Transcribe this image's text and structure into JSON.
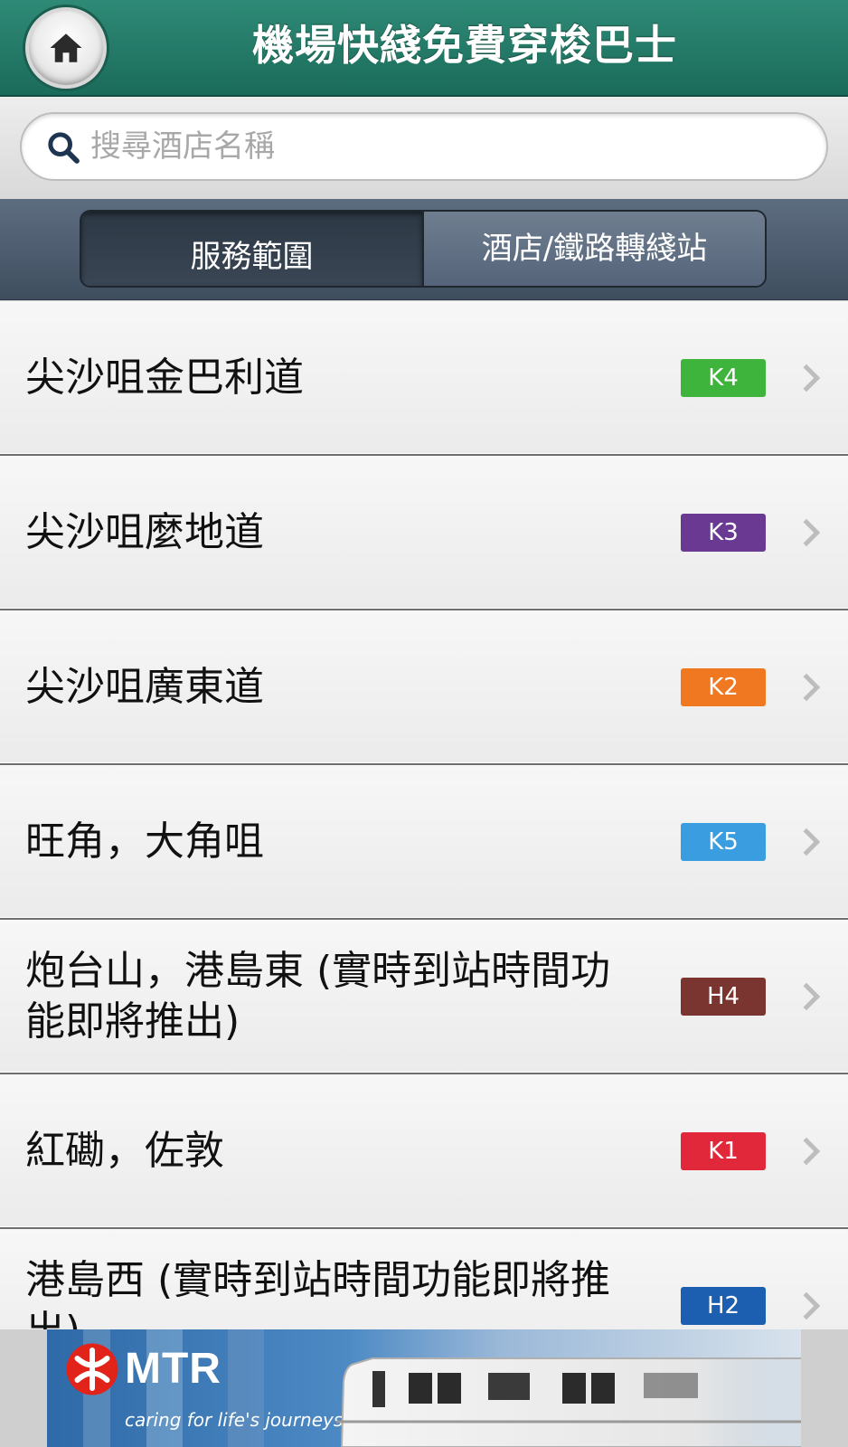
{
  "header": {
    "title": "機場快綫免費穿梭巴士",
    "home_icon": "home-icon"
  },
  "search": {
    "placeholder": "搜尋酒店名稱",
    "icon": "search-icon"
  },
  "tabs": [
    {
      "label": "服務範圍",
      "active": true
    },
    {
      "label": "酒店/鐵路轉綫站",
      "active": false
    }
  ],
  "routes": [
    {
      "label": "尖沙咀金巴利道",
      "code": "K4",
      "color": "#3fb43c"
    },
    {
      "label": "尖沙咀麼地道",
      "code": "K3",
      "color": "#6a3a93"
    },
    {
      "label": "尖沙咀廣東道",
      "code": "K2",
      "color": "#f07820"
    },
    {
      "label": "旺角，大角咀",
      "code": "K5",
      "color": "#3a9de0"
    },
    {
      "label": "炮台山，港島東 (實時到站時間功能即將推出)",
      "code": "H4",
      "color": "#7a3530"
    },
    {
      "label": "紅磡，佐敦",
      "code": "K1",
      "color": "#e0283a"
    },
    {
      "label": "港島西 (實時到站時間功能即將推出)",
      "code": "H2",
      "color": "#1c5fb0"
    }
  ],
  "ad": {
    "brand": "MTR",
    "tagline": "caring for life's journeys"
  }
}
